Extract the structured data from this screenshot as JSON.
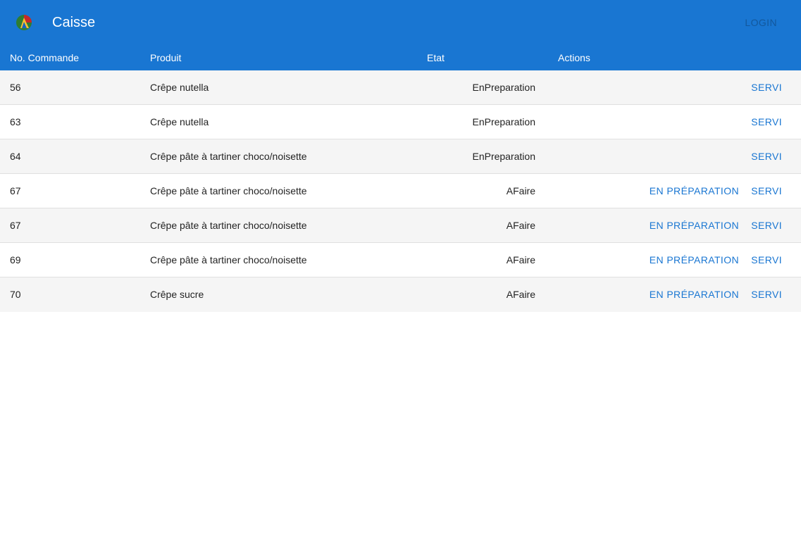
{
  "app": {
    "title": "Caisse",
    "login_label": "LOGIN",
    "accent_color": "#1976d2"
  },
  "table": {
    "headers": {
      "num": "No. Commande",
      "produit": "Produit",
      "etat": "Etat",
      "actions": "Actions"
    },
    "rows": [
      {
        "num": "56",
        "produit": "Crêpe nutella",
        "etat": "EnPreparation",
        "prep_label": "",
        "servi_label": "SERVI"
      },
      {
        "num": "63",
        "produit": "Crêpe nutella",
        "etat": "EnPreparation",
        "prep_label": "",
        "servi_label": "SERVI"
      },
      {
        "num": "64",
        "produit": "Crêpe pâte à tartiner choco/noisette",
        "etat": "EnPreparation",
        "prep_label": "",
        "servi_label": "SERVI"
      },
      {
        "num": "67",
        "produit": "Crêpe pâte à tartiner choco/noisette",
        "etat": "AFaire",
        "prep_label": "EN PRÉPARATION",
        "servi_label": "SERVI"
      },
      {
        "num": "67",
        "produit": "Crêpe pâte à tartiner choco/noisette",
        "etat": "AFaire",
        "prep_label": "EN PRÉPARATION",
        "servi_label": "SERVI"
      },
      {
        "num": "69",
        "produit": "Crêpe pâte à tartiner choco/noisette",
        "etat": "AFaire",
        "prep_label": "EN PRÉPARATION",
        "servi_label": "SERVI"
      },
      {
        "num": "70",
        "produit": "Crêpe sucre",
        "etat": "AFaire",
        "prep_label": "EN PRÉPARATION",
        "servi_label": "SERVI"
      }
    ]
  }
}
